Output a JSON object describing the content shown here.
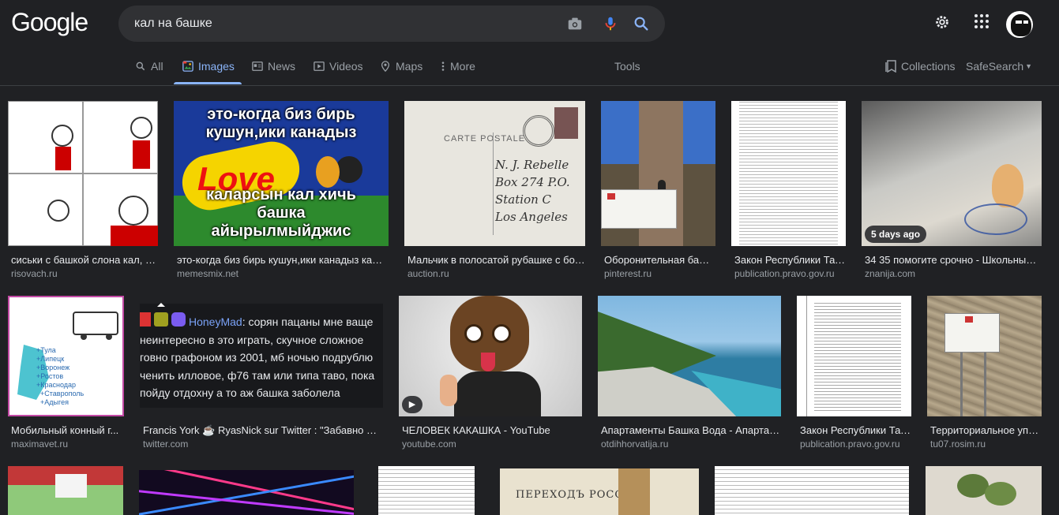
{
  "header": {
    "logo": "Google",
    "search_value": "кал на башке",
    "icons": [
      "camera-icon",
      "mic-icon",
      "search-icon",
      "gear-icon",
      "apps-grid-icon",
      "avatar"
    ]
  },
  "tabs": [
    {
      "label": "All",
      "icon": "search-icon"
    },
    {
      "label": "Images",
      "icon": "images-icon",
      "active": true
    },
    {
      "label": "News",
      "icon": "news-icon"
    },
    {
      "label": "Videos",
      "icon": "play-icon"
    },
    {
      "label": "Maps",
      "icon": "pin-icon"
    },
    {
      "label": "More",
      "icon": "kebab-icon"
    }
  ],
  "tools_label": "Tools",
  "collections_label": "Collections",
  "safesearch_label": "SafeSearch",
  "results": [
    {
      "caption": "сиськи с башкой слона кал, в...",
      "source": "risovach.ru",
      "thumb_text": ""
    },
    {
      "caption": "это-когда биз бирь кушун,ики канадыз кала...",
      "source": "memesmix.net",
      "thumb_text": "это-когда биз бирь кушун,ики канадыз каларсын кал хичь башка айырылмыйджис"
    },
    {
      "caption": "Мальчик в полосатой рубашке с бол...",
      "source": "auction.ru",
      "thumb_text": "CARTE POSTALE"
    },
    {
      "caption": "Оборонительная баш...",
      "source": "pinterest.ru",
      "thumb_text": ""
    },
    {
      "caption": "Закон Республики Тат...",
      "source": "publication.pravo.gov.ru",
      "thumb_text": ""
    },
    {
      "caption": "34 35 помогите срочно - Школьные ...",
      "source": "znanija.com",
      "badge": "5 days ago",
      "thumb_text": ""
    },
    {
      "caption": "Мобильный конный г...",
      "source": "maximavet.ru",
      "thumb_text": "Тула Липецк Воронеж Ростов Краснодар Ставрополь Адыгея"
    },
    {
      "caption": "Francis York ☕ RyasNick sur Twitter : \"Забавно что...",
      "source": "twitter.com",
      "thumb_text": "HoneyMad: сорян пацаны мне ваще неинтересно в это играть, скучное сложное говно графоном из 2001, мб ночью подрублю ченить илловое, ф76 там или типа таво, пока пойду отдохну а то аж башка заболела"
    },
    {
      "caption": "ЧЕЛОВЕК КАКАШКА - YouTube",
      "source": "youtube.com",
      "thumb_text": ""
    },
    {
      "caption": "Апартаменты Башка Вода - Апартаме...",
      "source": "otdihhorvatija.ru",
      "thumb_text": ""
    },
    {
      "caption": "Закон Республики Тат...",
      "source": "publication.pravo.gov.ru",
      "thumb_text": ""
    },
    {
      "caption": "Территориальное упр...",
      "source": "tu07.rosim.ru",
      "thumb_text": ""
    }
  ],
  "partial_row_thumb_text": "ПЕРЕХОДЪ РОССІИ"
}
